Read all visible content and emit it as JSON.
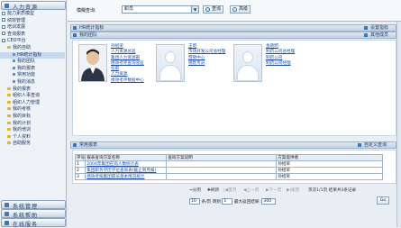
{
  "sidebar": {
    "top_header": "人力资源",
    "items": [
      {
        "label": "能力素质模型",
        "level": "l1",
        "mark": "m"
      },
      {
        "label": "绩效管理",
        "level": "l1",
        "mark": "m"
      },
      {
        "label": "培训发展",
        "level": "l1",
        "mark": "m"
      },
      {
        "label": "查询报表",
        "level": "l1",
        "mark": "m"
      },
      {
        "label": "CEO平台",
        "level": "l1",
        "mark": "m"
      },
      {
        "label": "我的自助",
        "level": "l2",
        "mark": "f"
      },
      {
        "label": "HR统计指标",
        "level": "l3",
        "mark": "s",
        "selected": true
      },
      {
        "label": "我的团队",
        "level": "l3",
        "mark": "s"
      },
      {
        "label": "我的报表",
        "level": "l3",
        "mark": "s"
      },
      {
        "label": "常用功能",
        "level": "l3",
        "mark": "s"
      },
      {
        "label": "我的消息",
        "level": "l3",
        "mark": "s"
      },
      {
        "label": "我的报表",
        "level": "l2",
        "mark": "f"
      },
      {
        "label": "组织人事查询",
        "level": "l2",
        "mark": "f"
      },
      {
        "label": "组织人力管理",
        "level": "l2",
        "mark": "f"
      },
      {
        "label": "我的考核",
        "level": "l2",
        "mark": "f"
      },
      {
        "label": "我的目标",
        "level": "l2",
        "mark": "f"
      },
      {
        "label": "我的计划",
        "level": "l2",
        "mark": "f"
      },
      {
        "label": "我的培训",
        "level": "l2",
        "mark": "f"
      },
      {
        "label": "个人资料",
        "level": "l2",
        "mark": "f"
      },
      {
        "label": "自助服务",
        "level": "l2",
        "mark": "f"
      }
    ],
    "bottom_headers": [
      "系统管理",
      "系统帮助",
      "在线服务"
    ]
  },
  "topbar": {
    "label": "模糊查询:",
    "select_value": "职员",
    "query_button": "查询",
    "advanced_button": "高级"
  },
  "panels": {
    "stats_title": "HR统计指标",
    "stats_right": "设置指标",
    "team_title": "我的团队",
    "team_right": "其他成员",
    "reports_title": "常用报表",
    "reports_right": "自定义查询"
  },
  "employees": [
    {
      "has_photo": true,
      "lines": [
        "孙绍荣",
        "人力资源总监",
        "集团人力资源部",
        "绩效考评查询总监",
        "任职",
        "人力资源",
        "绩效考评数据中心"
      ]
    },
    {
      "has_photo": false,
      "lines": [
        "王昭",
        "市场开发公司总经理",
        "营销中心",
        "销售专员"
      ]
    },
    {
      "has_photo": false,
      "lines": [
        "金晓明",
        "制药公司总经理",
        "制药公司",
        "制药公司经理"
      ]
    }
  ],
  "reports_table": {
    "headers": [
      "序号",
      "报表查询方案名称",
      "查询方案说明",
      "方案提供者"
    ],
    "rows": [
      [
        "1",
        "2004年集团在岗人数统计表",
        "",
        "孙绍荣"
      ],
      [
        "2",
        "集团职务学历学位查询表(截止到月报)",
        "",
        "孙绍荣"
      ],
      [
        "3",
        "绩效考核集团职员基本情况统计",
        "",
        "孙绍荣"
      ]
    ]
  },
  "pager": {
    "share": "分页",
    "refresh": "刷新",
    "first": "首页",
    "prev": "上一页",
    "next": "下一页",
    "last": "尾页",
    "status": "页次1/1页 结果共3条记录",
    "page_size_label": "条/页",
    "page_size": "10",
    "goto_label": "转到",
    "goto_value": "1",
    "records_label": "最大返回结果:",
    "records_value": "300",
    "go_button": "Go"
  }
}
